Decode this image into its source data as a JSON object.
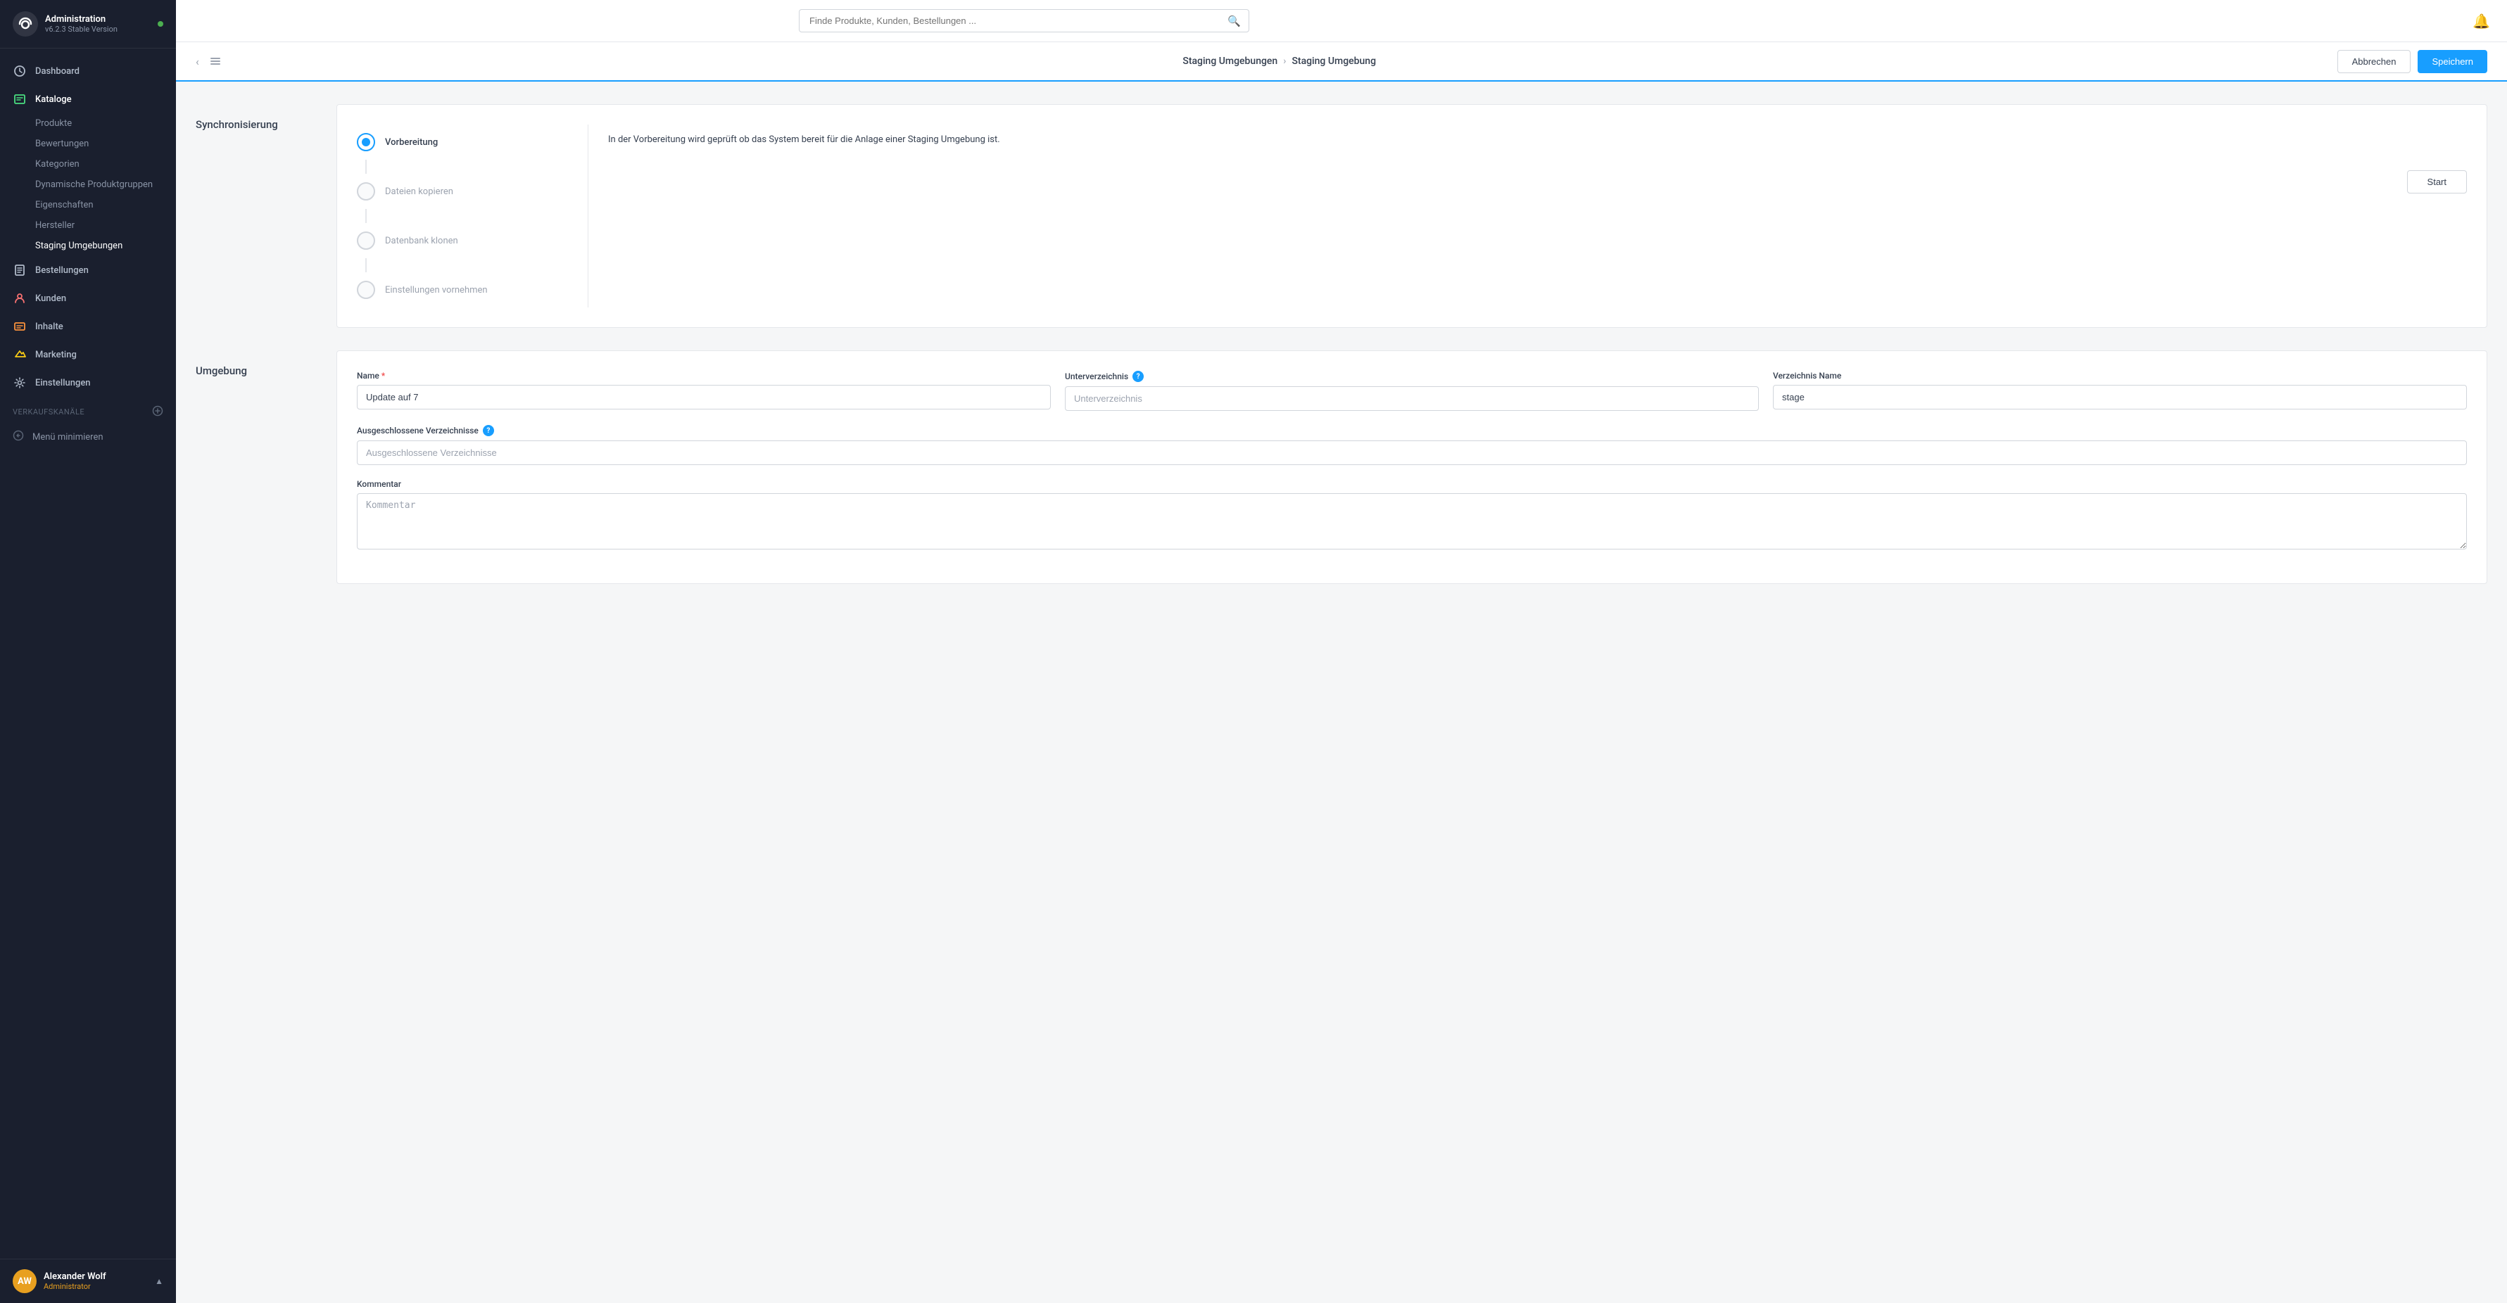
{
  "app": {
    "title": "Administration",
    "version": "v6.2.3 Stable Version",
    "online": true
  },
  "sidebar": {
    "nav_items": [
      {
        "id": "dashboard",
        "label": "Dashboard",
        "icon": "dashboard"
      },
      {
        "id": "kataloge",
        "label": "Kataloge",
        "icon": "catalog",
        "active": true
      },
      {
        "id": "bestellungen",
        "label": "Bestellungen",
        "icon": "orders"
      },
      {
        "id": "kunden",
        "label": "Kunden",
        "icon": "customers"
      },
      {
        "id": "inhalte",
        "label": "Inhalte",
        "icon": "content"
      },
      {
        "id": "marketing",
        "label": "Marketing",
        "icon": "marketing"
      },
      {
        "id": "einstellungen",
        "label": "Einstellungen",
        "icon": "settings"
      }
    ],
    "catalog_subitems": [
      {
        "id": "produkte",
        "label": "Produkte"
      },
      {
        "id": "bewertungen",
        "label": "Bewertungen"
      },
      {
        "id": "kategorien",
        "label": "Kategorien"
      },
      {
        "id": "dynamische-produktgruppen",
        "label": "Dynamische Produktgruppen"
      },
      {
        "id": "eigenschaften",
        "label": "Eigenschaften"
      },
      {
        "id": "hersteller",
        "label": "Hersteller"
      },
      {
        "id": "staging-umgebungen",
        "label": "Staging Umgebungen",
        "active": true
      }
    ],
    "verkaufskanaele": {
      "label": "Verkaufskanäle",
      "add_icon": "plus"
    },
    "minimize": {
      "label": "Menü minimieren"
    },
    "user": {
      "initials": "AW",
      "name": "Alexander Wolf",
      "role": "Administrator"
    }
  },
  "topbar": {
    "search_placeholder": "Finde Produkte, Kunden, Bestellungen ...",
    "search_icon": "search",
    "notification_icon": "bell"
  },
  "content_header": {
    "back_icon": "chevron-left",
    "list_icon": "list",
    "breadcrumb_parent": "Staging Umgebungen",
    "breadcrumb_separator": "›",
    "breadcrumb_current": "Staging Umgebung",
    "cancel_label": "Abbrechen",
    "save_label": "Speichern"
  },
  "synchronisierung": {
    "section_label": "Synchronisierung",
    "card": {
      "steps": [
        {
          "id": "vorbereitung",
          "label": "Vorbereitung",
          "state": "active"
        },
        {
          "id": "dateien-kopieren",
          "label": "Dateien kopieren",
          "state": "inactive"
        },
        {
          "id": "datenbank-klonen",
          "label": "Datenbank klonen",
          "state": "inactive"
        },
        {
          "id": "einstellungen-vornehmen",
          "label": "Einstellungen vornehmen",
          "state": "inactive"
        }
      ],
      "description": "In der Vorbereitung wird geprüft ob das System bereit für die Anlage einer Staging Umgebung ist.",
      "start_button": "Start"
    }
  },
  "umgebung": {
    "section_label": "Umgebung",
    "card": {
      "fields": {
        "name": {
          "label": "Name",
          "required": true,
          "value": "Update auf 7",
          "placeholder": ""
        },
        "unterverzeichnis": {
          "label": "Unterverzeichnis",
          "has_help": true,
          "value": "",
          "placeholder": "Unterverzeichnis"
        },
        "verzeichnis_name": {
          "label": "Verzeichnis Name",
          "value": "stage",
          "placeholder": ""
        },
        "ausgeschlossene_verzeichnisse": {
          "label": "Ausgeschlossene Verzeichnisse",
          "has_help": true,
          "value": "",
          "placeholder": "Ausgeschlossene Verzeichnisse"
        },
        "kommentar": {
          "label": "Kommentar",
          "value": "",
          "placeholder": "Kommentar"
        }
      }
    }
  }
}
